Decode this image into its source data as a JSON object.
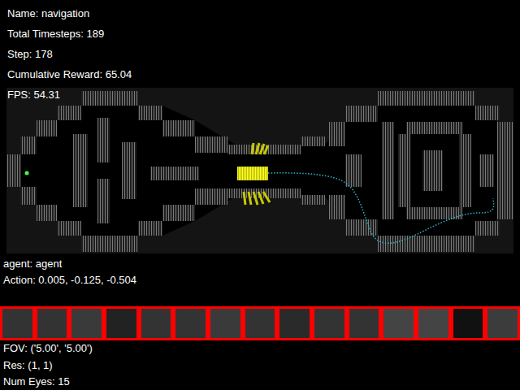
{
  "hud": {
    "lines": [
      "Name: navigation",
      "Total Timesteps: 189",
      "Step: 178",
      "Cumulative Reward: 65.04",
      "FPS: 54.31"
    ]
  },
  "agent_info": {
    "lines": [
      "agent: agent",
      "Action: 0.005, -0.125, -0.504"
    ]
  },
  "eyes": [
    {
      "color": "#333333"
    },
    {
      "color": "#333333"
    },
    {
      "color": "#3a3a3a"
    },
    {
      "color": "#222222"
    },
    {
      "color": "#333333"
    },
    {
      "color": "#333333"
    },
    {
      "color": "#3a3a3a"
    },
    {
      "color": "#333333"
    },
    {
      "color": "#2a2a2a"
    },
    {
      "color": "#333333"
    },
    {
      "color": "#333333"
    },
    {
      "color": "#444444"
    },
    {
      "color": "#444444"
    },
    {
      "color": "#111111"
    },
    {
      "color": "#3c3c3c"
    }
  ],
  "camera": {
    "lines": [
      "FOV: ('5.00', '5.00')",
      "Res: (1, 1)",
      "Num Eyes: 15"
    ]
  }
}
